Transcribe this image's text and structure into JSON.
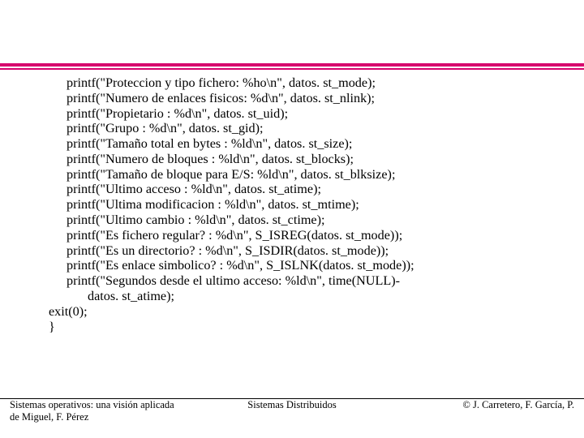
{
  "code": {
    "lines": [
      {
        "cls": "indent-line",
        "text": "printf(\"Proteccion y tipo fichero: %ho\\n\", datos. st_mode);"
      },
      {
        "cls": "indent-line",
        "text": "printf(\"Numero de enlaces fisicos: %d\\n\", datos. st_nlink);"
      },
      {
        "cls": "indent-line",
        "text": "printf(\"Propietario : %d\\n\", datos. st_uid);"
      },
      {
        "cls": "indent-line",
        "text": "printf(\"Grupo : %d\\n\", datos. st_gid);"
      },
      {
        "cls": "indent-line",
        "text": "printf(\"Tamaño total en bytes : %ld\\n\", datos. st_size);"
      },
      {
        "cls": "indent-line",
        "text": "printf(\"Numero de bloques : %ld\\n\", datos. st_blocks);"
      },
      {
        "cls": "indent-line",
        "text": "printf(\"Tamaño de bloque para E/S: %ld\\n\", datos. st_blksize);"
      },
      {
        "cls": "indent-line",
        "text": "printf(\"Ultimo acceso : %ld\\n\", datos. st_atime);"
      },
      {
        "cls": "indent-line",
        "text": "printf(\"Ultima modificacion : %ld\\n\", datos. st_mtime);"
      },
      {
        "cls": "indent-line",
        "text": "printf(\"Ultimo cambio : %ld\\n\", datos. st_ctime);"
      },
      {
        "cls": "indent-line",
        "text": "printf(\"Es fichero regular? : %d\\n\", S_ISREG(datos. st_mode));"
      },
      {
        "cls": "indent-line",
        "text": "printf(\"Es un directorio? : %d\\n\", S_ISDIR(datos. st_mode));"
      },
      {
        "cls": "indent-line",
        "text": "printf(\"Es enlace simbolico? : %d\\n\", S_ISLNK(datos. st_mode));"
      },
      {
        "cls": "indent-line",
        "text": "printf(\"Segundos desde el ultimo acceso: %ld\\n\", time(NULL)-"
      },
      {
        "cls": "indent-line2",
        "text": "datos. st_atime);"
      },
      {
        "cls": "no-indent",
        "text": "exit(0);"
      },
      {
        "cls": "no-indent",
        "text": "}"
      }
    ]
  },
  "footer": {
    "left_line1": "Sistemas operativos: una visión aplicada",
    "left_line2": "de Miguel, F. Pérez",
    "center": "Sistemas Distribuidos",
    "right": "© J. Carretero, F. García, P."
  }
}
